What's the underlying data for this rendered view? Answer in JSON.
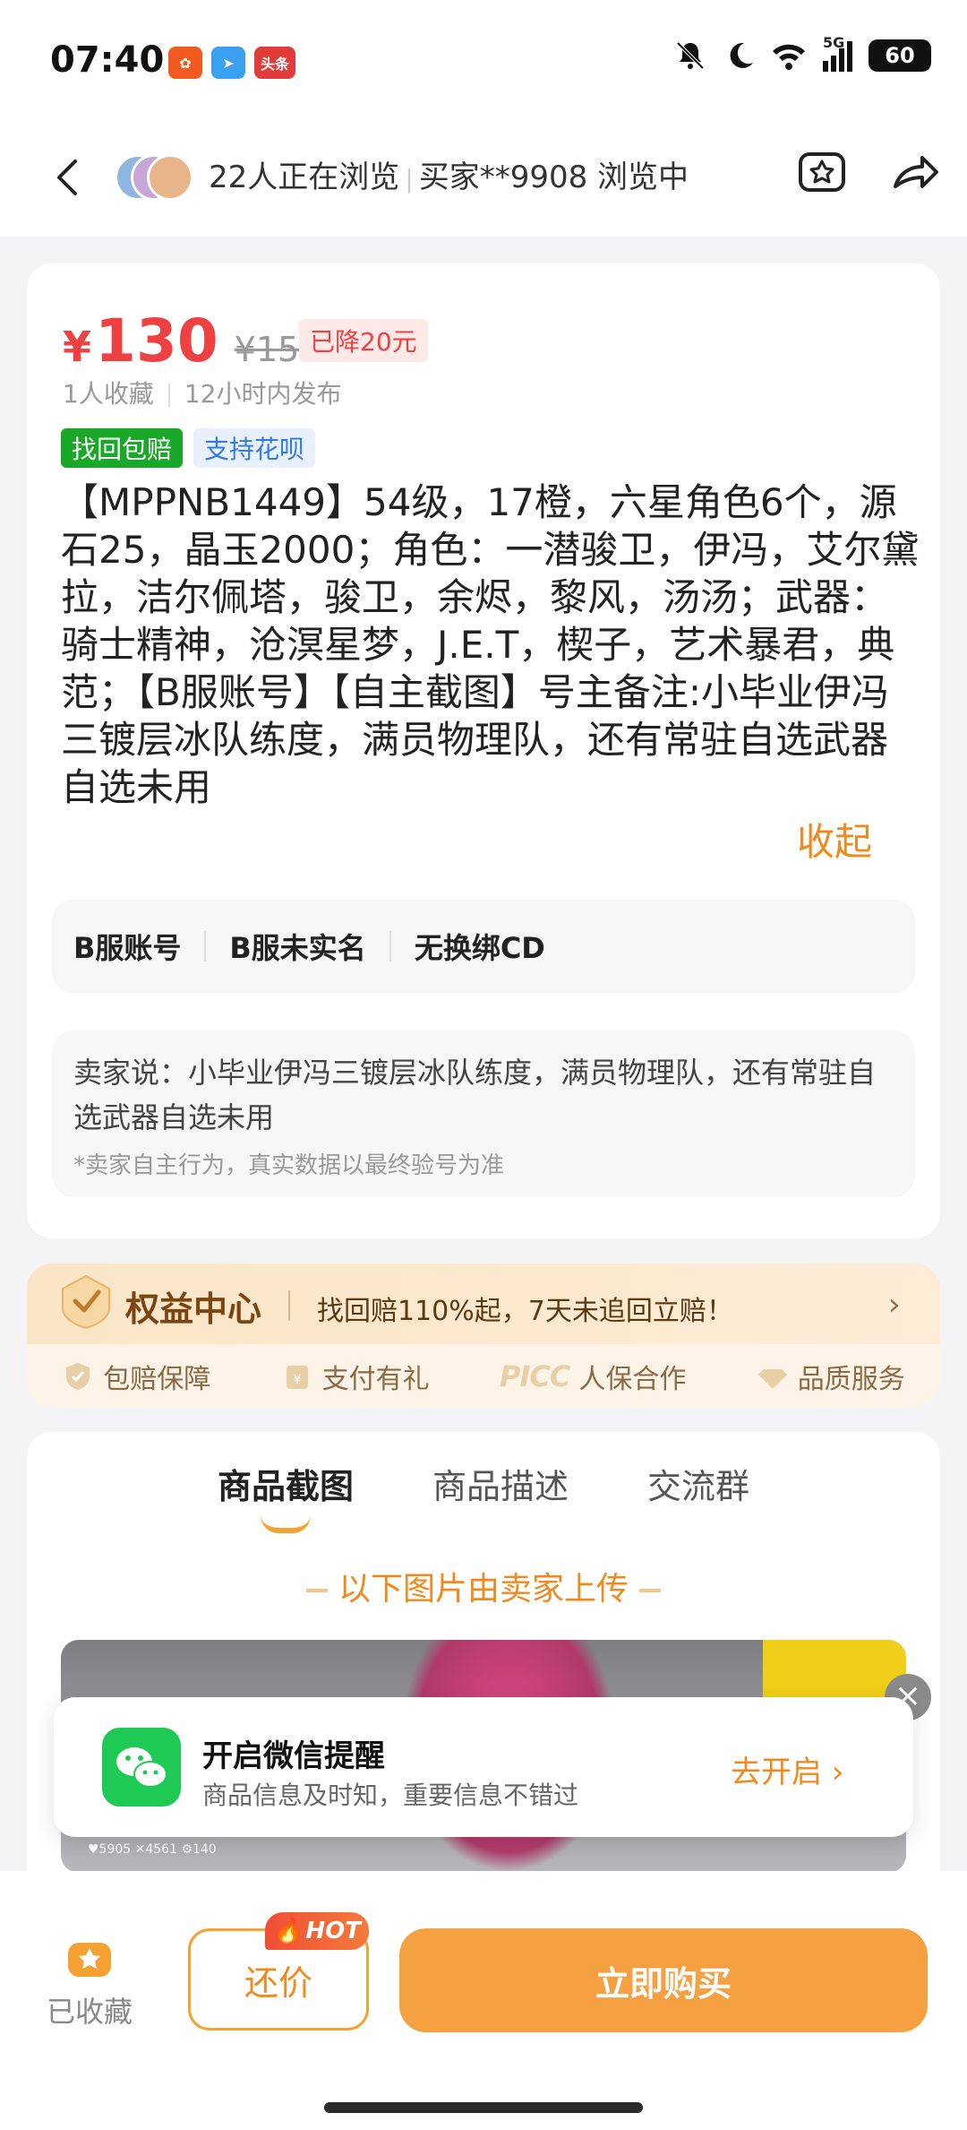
{
  "status": {
    "time": "07:40",
    "app_badge_text": "头条",
    "network": "5G",
    "battery": "60"
  },
  "nav": {
    "viewers_text": "22人正在浏览",
    "buyer_text": "买家**9908 浏览中"
  },
  "product": {
    "currency": "¥",
    "price": "130",
    "original_price": "¥150",
    "drop_label": "已降20元",
    "favorites": "1人收藏",
    "published": "12小时内发布",
    "tags": [
      "找回包赔",
      "支持花呗"
    ],
    "description": "【MPPNB1449】54级，17橙，六星角色6个，源石25，晶玉2000；角色：一潜骏卫，伊冯，艾尔黛拉，洁尔佩塔，骏卫，余烬，黎风，汤汤；武器：骑士精神，沧溟星梦，J.E.T，楔子，艺术暴君，典范；【B服账号】【自主截图】号主备注:小毕业伊冯三镀层冰队练度，满员物理队，还有常驻自选武器自选未用",
    "collapse_label": "收起",
    "props": [
      "B服账号",
      "B服未实名",
      "无换绑CD"
    ],
    "seller_says": "卖家说：小毕业伊冯三镀层冰队练度，满员物理队，还有常驻自选武器自选未用",
    "seller_note": "*卖家自主行为，真实数据以最终验号为准"
  },
  "rights": {
    "title": "权益中心",
    "promo": "找回赔110%起，7天未追回立赔！",
    "items": [
      "包赔保障",
      "支付有礼",
      "人保合作",
      "品质服务"
    ],
    "picc_logo": "PICC"
  },
  "tabs": {
    "items": [
      "商品截图",
      "商品描述",
      "交流群"
    ],
    "active": 0,
    "upload_note": "以下图片由卖家上传"
  },
  "screenshot": {
    "stats": "♥5905  ✕4561  ⚙140"
  },
  "wechat_popup": {
    "title": "开启微信提醒",
    "subtitle": "商品信息及时知，重要信息不错过",
    "action": "去开启"
  },
  "bottom": {
    "fav_label": "已收藏",
    "bargain_label": "还价",
    "hot_label": "HOT",
    "buy_label": "立即购买"
  },
  "colors": {
    "price_red": "#f04142",
    "accent_orange": "#f5a041",
    "green_tag": "#1aa829",
    "wechat_green": "#1ec954"
  }
}
